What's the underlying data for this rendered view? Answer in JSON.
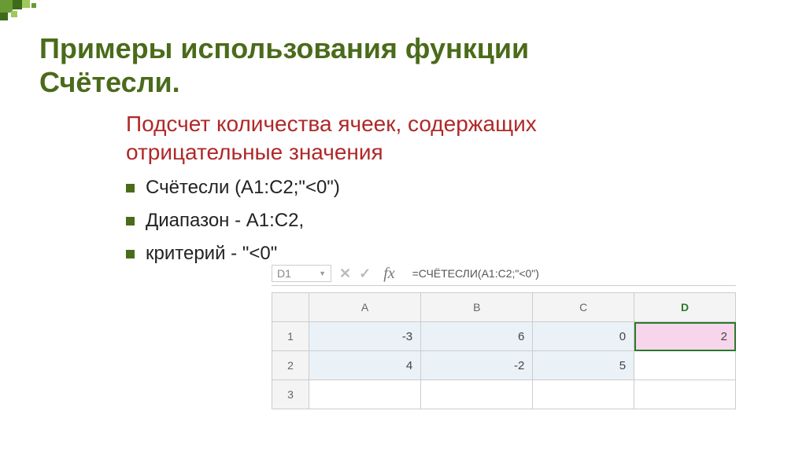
{
  "title_line1": "Примеры использования функции",
  "title_line2": "Счётесли.",
  "subtitle_line1": "Подсчет количества ячеек, содержащих",
  "subtitle_line2": "отрицательные значения",
  "bullets": [
    "Счётесли (A1:С2;\"<0\")",
    "Диапазон - А1:С2,",
    "критерий - \"<0\""
  ],
  "excel": {
    "namebox": "D1",
    "formula": "=СЧЁТЕСЛИ(A1:C2;\"<0\")",
    "columns": [
      "A",
      "B",
      "C",
      "D"
    ],
    "rows": [
      "1",
      "2",
      "3"
    ]
  },
  "chart_data": {
    "type": "table",
    "columns": [
      "A",
      "B",
      "C",
      "D"
    ],
    "rows": [
      {
        "A": -3,
        "B": 6,
        "C": 0,
        "D": 2
      },
      {
        "A": 4,
        "B": -2,
        "C": 5,
        "D": ""
      },
      {
        "A": "",
        "B": "",
        "C": "",
        "D": ""
      }
    ],
    "selected_range": "A1:C2",
    "active_cell": "D1",
    "formula": "=СЧЁТЕСЛИ(A1:C2;\"<0\")"
  },
  "deco_colors": {
    "dark": "#3e6b1a",
    "mid": "#6a9a33",
    "light": "#9fc95a"
  }
}
